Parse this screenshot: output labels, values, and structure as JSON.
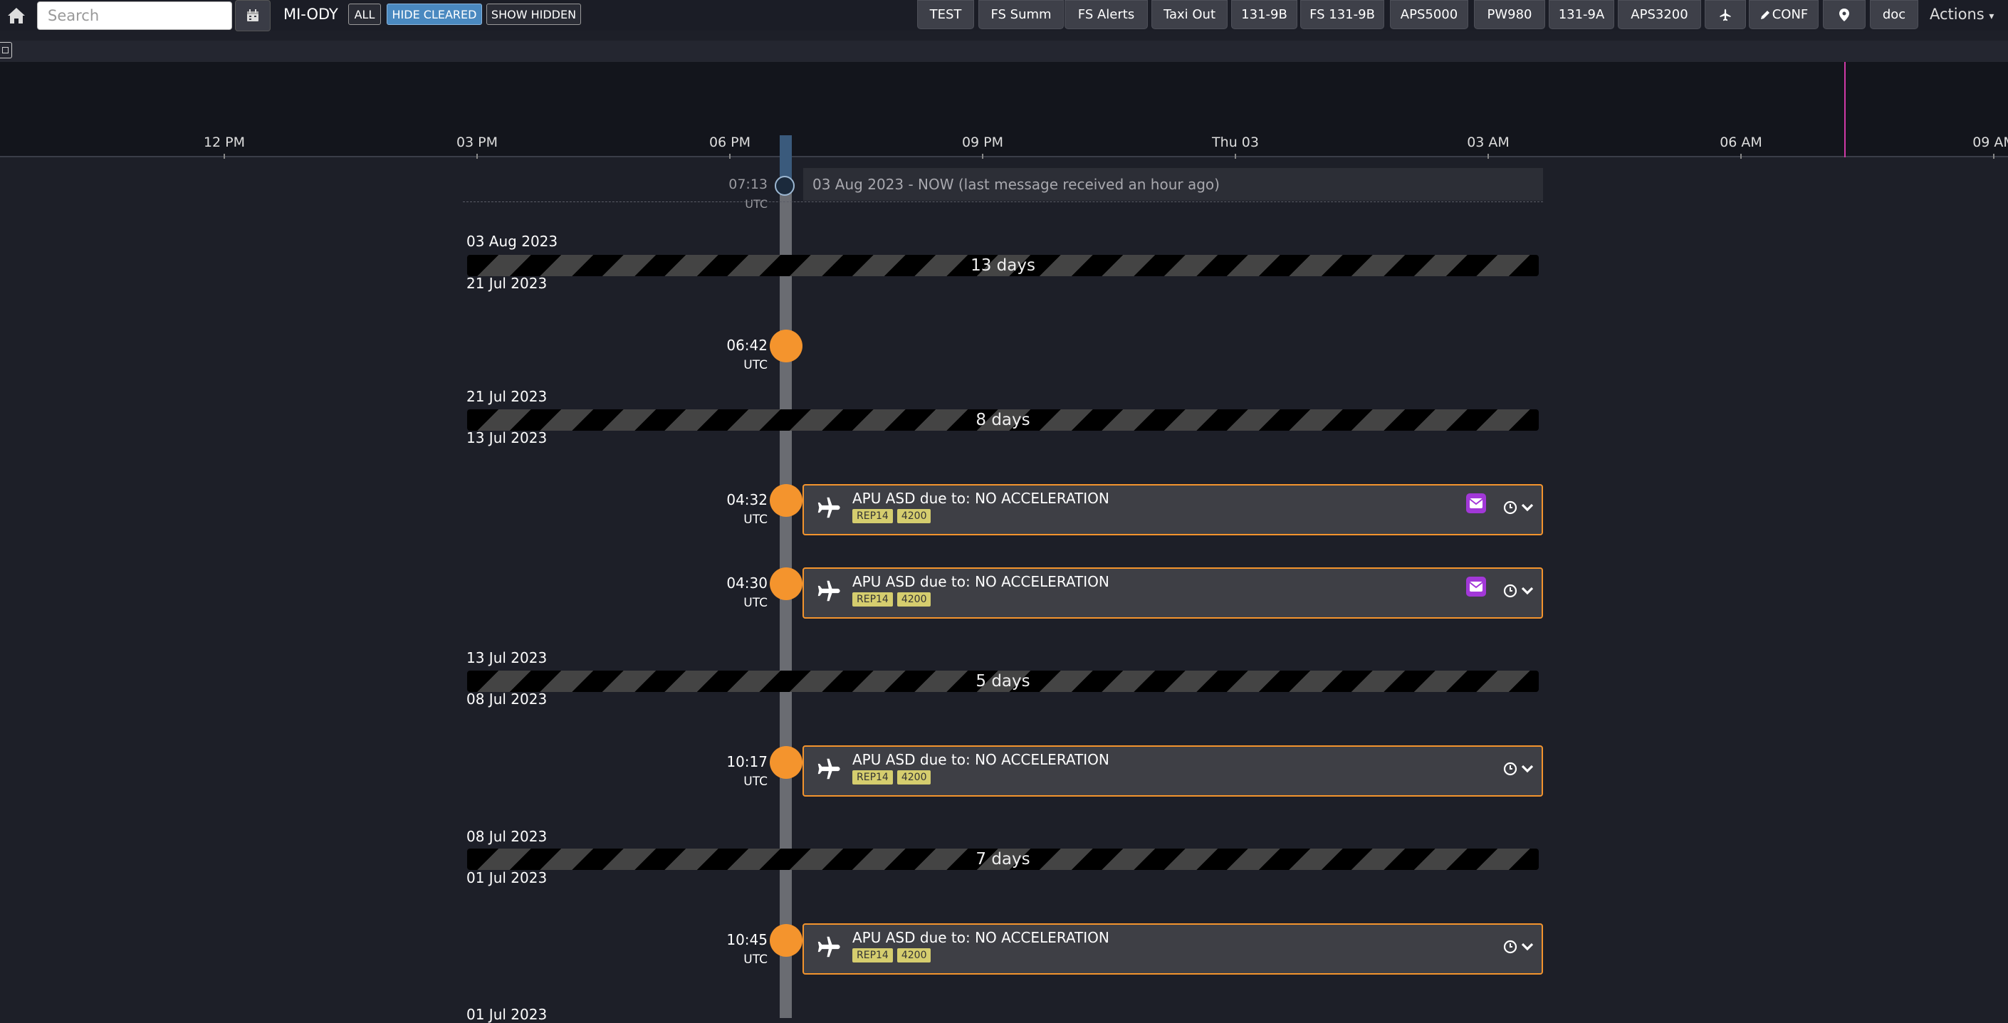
{
  "toolbar": {
    "search_placeholder": "Search",
    "registration": "MI-ODY",
    "filters": [
      "ALL",
      "HIDE CLEARED",
      "SHOW HIDDEN"
    ],
    "buttons": [
      "TEST",
      "FS Summ",
      "FS Alerts",
      "Taxi Out",
      "131-9B",
      "FS 131-9B",
      "APS5000",
      "PW980",
      "131-9A",
      "APS3200",
      "",
      "CONF",
      "",
      "doc"
    ],
    "actions_label": "Actions"
  },
  "timeline_axis": {
    "ticks": [
      "12 PM",
      "03 PM",
      "06 PM",
      "09 PM",
      "Thu 03",
      "03 AM",
      "06 AM",
      "09 AM"
    ]
  },
  "now_marker": {
    "time": "07:13",
    "tz": "UTC",
    "text": "03 Aug 2023 - NOW (last message received an hour ago)"
  },
  "gaps": [
    {
      "from": "03 Aug 2023",
      "to": "21 Jul 2023",
      "label": "13 days"
    },
    {
      "from": "21 Jul 2023",
      "to": "13 Jul 2023",
      "label": "8 days"
    },
    {
      "from": "13 Jul 2023",
      "to": "08 Jul 2023",
      "label": "5 days"
    },
    {
      "from": "08 Jul 2023",
      "to": "01 Jul 2023",
      "label": "7 days"
    }
  ],
  "tail_date": "01 Jul 2023",
  "events": [
    {
      "time": "06:42",
      "tz": "UTC"
    },
    {
      "time": "04:32",
      "tz": "UTC",
      "title": "APU ASD due to: NO ACCELERATION",
      "tags": [
        "REP14",
        "4200"
      ],
      "has_mail": true
    },
    {
      "time": "04:30",
      "tz": "UTC",
      "title": "APU ASD due to: NO ACCELERATION",
      "tags": [
        "REP14",
        "4200"
      ],
      "has_mail": true
    },
    {
      "time": "10:17",
      "tz": "UTC",
      "title": "APU ASD due to: NO ACCELERATION",
      "tags": [
        "REP14",
        "4200"
      ],
      "has_mail": false
    },
    {
      "time": "10:45",
      "tz": "UTC",
      "title": "APU ASD due to: NO ACCELERATION",
      "tags": [
        "REP14",
        "4200"
      ],
      "has_mail": false
    }
  ],
  "icons": {
    "home": "home-icon",
    "calendar": "calendar-icon",
    "plane": "plane-icon",
    "pin": "map-pin-icon",
    "pencil": "pencil-icon",
    "mail": "mail-icon",
    "clock": "clock-icon",
    "chevron": "chevron-down-icon"
  },
  "colors": {
    "event_accent": "#f4942d",
    "active_filter": "#4a89c0",
    "now_line": "#d03aa8",
    "mail_badge": "#a238d8",
    "tag_bg": "#d5cd6e"
  }
}
